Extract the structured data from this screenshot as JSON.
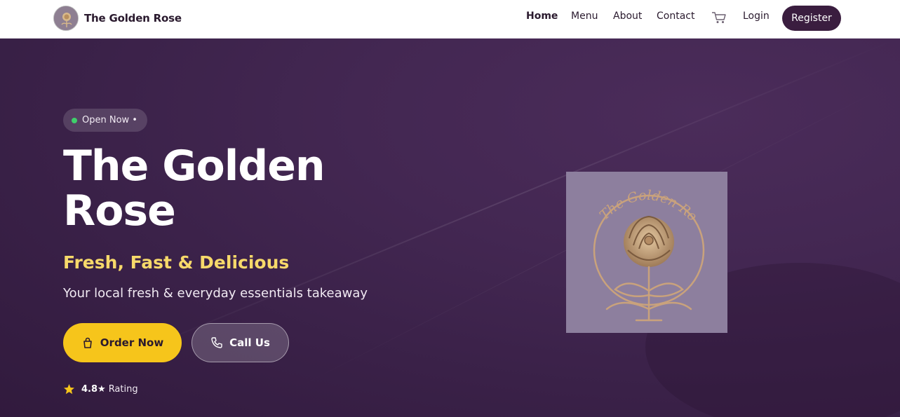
{
  "nav": {
    "brand_name": "The Golden Rose",
    "links": [
      {
        "label": "Home",
        "active": true
      },
      {
        "label": "Menu",
        "active": false
      },
      {
        "label": "About",
        "active": false
      },
      {
        "label": "Contact",
        "active": false
      }
    ],
    "cart_icon": "cart-icon",
    "login_label": "Login",
    "register_label": "Register"
  },
  "hero": {
    "badge_text": "Open Now •",
    "title": "The Golden Rose",
    "tagline": "Fresh, Fast & Delicious",
    "description": "Your local fresh & everyday essentials takeaway",
    "order_button": "Order Now",
    "call_button": "Call Us",
    "rating_value": "4.8★",
    "rating_label": "Rating",
    "logo_text": "The Golden Rose"
  },
  "colors": {
    "brand_dark": "#3a1d3f",
    "hero_bg": "#432752",
    "accent_yellow": "#f6c51b",
    "tagline_yellow": "#f7d96a",
    "open_green": "#3fcf6b",
    "logo_bg": "#8d7f9e",
    "logo_gold": "#c9a27c"
  }
}
